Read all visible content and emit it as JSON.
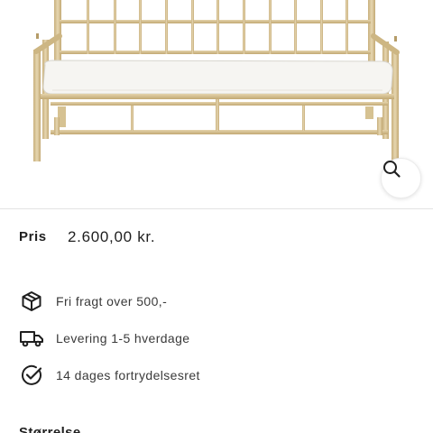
{
  "product": {
    "image_alt": "Bambus sofa med hvid hynde",
    "zoom_icon": "search-icon"
  },
  "price": {
    "label": "Pris",
    "value": "2.600,00 kr."
  },
  "usps": [
    {
      "icon": "package-icon",
      "text": "Fri fragt over 500,-"
    },
    {
      "icon": "truck-icon",
      "text": "Levering 1-5 hverdage"
    },
    {
      "icon": "check-circle-icon",
      "text": "14 dages fortrydelsesret"
    }
  ],
  "options": {
    "size_heading": "Størrelse"
  },
  "colors": {
    "text": "#1f1f1f",
    "bamboo": "#d9c59a",
    "cushion": "#f6f5f2"
  }
}
